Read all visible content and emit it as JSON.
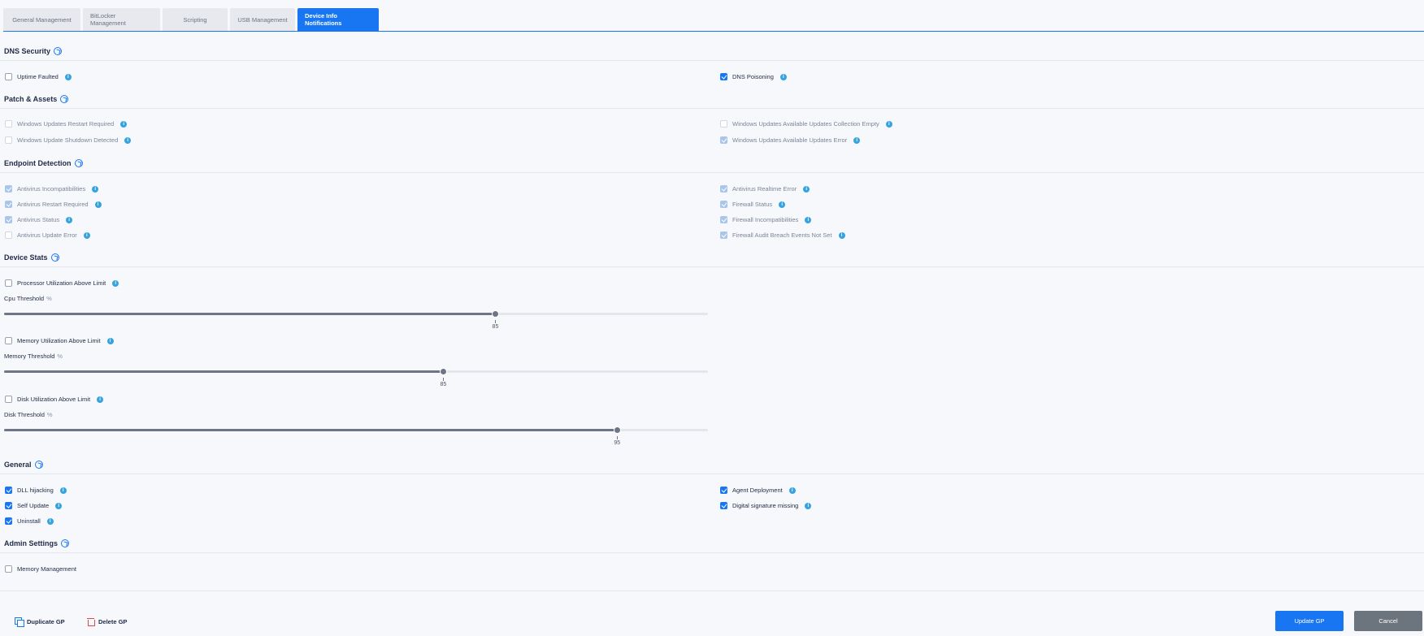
{
  "tabs": [
    "General Management",
    "BitLocker Management",
    "Scripting",
    "USB Management",
    "Device Info Notifications"
  ],
  "sections": {
    "dns_security": {
      "title": "DNS Security",
      "items": [
        {
          "label": "Uptime Faulted",
          "checked": false
        },
        {
          "label": "DNS Poisoning",
          "checked": true
        }
      ]
    },
    "patch_assets": {
      "title": "Patch & Assets",
      "items": [
        {
          "label": "Windows Updates Restart Required",
          "checked": false
        },
        {
          "label": "Windows Update Shutdown Detected",
          "checked": false
        },
        {
          "label": "Windows Updates Available Updates Collection Empty",
          "checked": false
        },
        {
          "label": "Windows Updates Available Updates Error",
          "checked": true
        }
      ]
    },
    "endpoint_detection": {
      "title": "Endpoint Detection",
      "items": [
        {
          "label": "Antivirus Incompatibilities",
          "checked": true
        },
        {
          "label": "Antivirus Restart Required",
          "checked": true
        },
        {
          "label": "Antivirus Status",
          "checked": true
        },
        {
          "label": "Antivirus Update Error",
          "checked": false
        },
        {
          "label": "Antivirus Realtime Error",
          "checked": true
        },
        {
          "label": "Firewall Status",
          "checked": true
        },
        {
          "label": "Firewall Incompatibilities",
          "checked": true
        },
        {
          "label": "Firewall Audit Breach Events Not Set",
          "checked": true
        }
      ]
    },
    "device_stats": {
      "title": "Device Stats",
      "processor": {
        "label": "Processor Utilization Above Limit",
        "checked": false,
        "threshold_label": "Cpu Threshold",
        "unit": "%",
        "value": 85,
        "fill": 0.698
      },
      "memory": {
        "label": "Memory Utilization Above Limit",
        "checked": false,
        "threshold_label": "Memory Threshold",
        "unit": "%",
        "value": 85,
        "fill": 0.624
      },
      "disk": {
        "label": "Disk Utilization Above Limit",
        "checked": false,
        "threshold_label": "Disk Threshold",
        "unit": "%",
        "value": 95,
        "fill": 0.871
      }
    },
    "general": {
      "title": "General",
      "items": [
        {
          "label": "DLL hijacking",
          "checked": true
        },
        {
          "label": "Self Update",
          "checked": true
        },
        {
          "label": "Uninstall",
          "checked": true
        },
        {
          "label": "Agent Deployment",
          "checked": true
        },
        {
          "label": "Digital signature missing",
          "checked": true
        }
      ]
    },
    "admin_settings": {
      "title": "Admin Settings",
      "items": [
        {
          "label": "Memory Management",
          "checked": false
        }
      ]
    }
  },
  "footer": {
    "duplicate": "Duplicate GP",
    "delete": "Delete GP",
    "update": "Update GP",
    "cancel": "Cancel"
  },
  "colors": {
    "accent": "#1976f2",
    "danger": "#e0474c",
    "info": "#35a3dd",
    "secondary": "#6c757d"
  }
}
